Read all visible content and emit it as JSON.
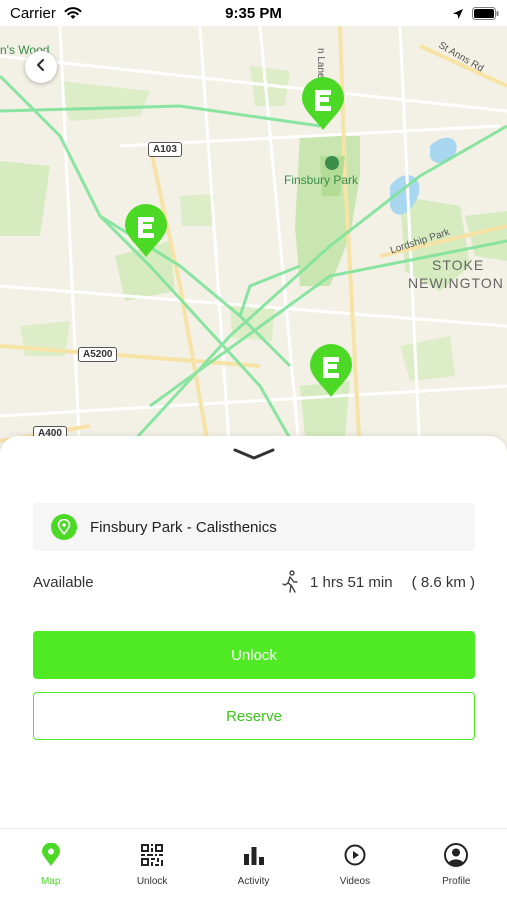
{
  "status_bar": {
    "carrier": "Carrier",
    "time": "9:35 PM"
  },
  "map": {
    "labels": {
      "woods": "n's Wood",
      "finsbury_park": "Finsbury Park",
      "lordship_park": "Lordship Park",
      "stoke": "STOKE",
      "newington": "NEWINGTON",
      "st_anns": "St Anns Rd",
      "lanes": "n Lanes"
    },
    "road_badges": {
      "a103": "A103",
      "a5200": "A5200",
      "a400": "A400"
    }
  },
  "sheet": {
    "location_name": "Finsbury Park - Calisthenics",
    "availability": "Available",
    "walk_time": "1 hrs 51 min",
    "distance": "( 8.6 km )",
    "unlock_label": "Unlock",
    "reserve_label": "Reserve"
  },
  "tabs": [
    {
      "label": "Map",
      "icon": "map-pin-icon",
      "active": true
    },
    {
      "label": "Unlock",
      "icon": "qr-code-icon",
      "active": false
    },
    {
      "label": "Activity",
      "icon": "bar-chart-icon",
      "active": false
    },
    {
      "label": "Videos",
      "icon": "play-circle-icon",
      "active": false
    },
    {
      "label": "Profile",
      "icon": "user-circle-icon",
      "active": false
    }
  ],
  "colors": {
    "accent": "#50ea25",
    "accent_text": "#3dc41c",
    "map_background": "#f3f0e5",
    "park_green": "#c9e6b0",
    "route_green": "#7fe39a",
    "water": "#a9d7f0"
  }
}
